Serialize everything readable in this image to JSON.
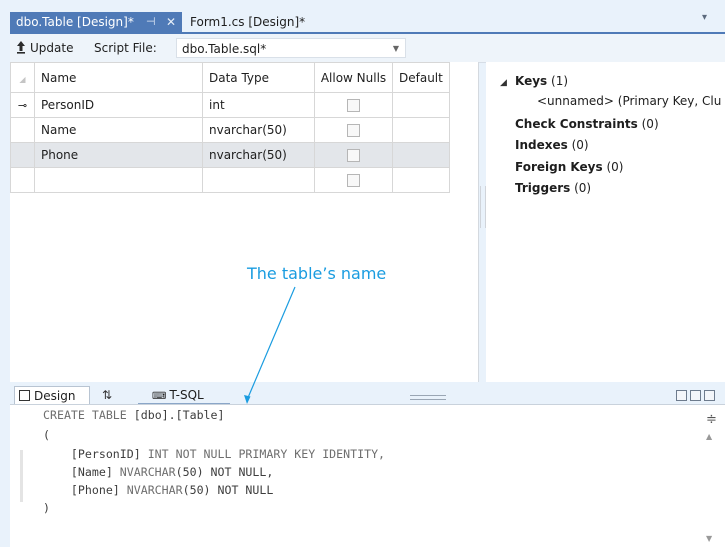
{
  "tabs": {
    "active": {
      "label": "dbo.Table [Design]*",
      "pin": "⊣",
      "close": "✕"
    },
    "inactive": {
      "label": "Form1.cs [Design]*"
    },
    "overflow": "▾"
  },
  "toolbar": {
    "update_label": "Update",
    "script_file_label": "Script File:",
    "script_file_value": "dbo.Table.sql*"
  },
  "grid": {
    "headers": [
      "Name",
      "Data Type",
      "Allow Nulls",
      "Default"
    ],
    "rows": [
      {
        "name": "PersonID",
        "type": "int",
        "allow_nulls": false,
        "primary_key": true
      },
      {
        "name": "Name",
        "type": "nvarchar(50)",
        "allow_nulls": false,
        "primary_key": false
      },
      {
        "name": "Phone",
        "type": "nvarchar(50)",
        "allow_nulls": false,
        "primary_key": false,
        "selected": true
      },
      {
        "name": "",
        "type": "",
        "allow_nulls": false,
        "primary_key": false
      }
    ]
  },
  "properties": {
    "keys_label": "Keys",
    "keys_count": "(1)",
    "keys_item": "<unnamed>  (Primary Key, Clu",
    "check_label": "Check Constraints",
    "check_count": "(0)",
    "indexes_label": "Indexes",
    "indexes_count": "(0)",
    "fk_label": "Foreign Keys",
    "fk_count": "(0)",
    "triggers_label": "Triggers",
    "triggers_count": "(0)"
  },
  "bottom_tabs": {
    "design": "Design",
    "swap": "⇅",
    "tsql": "T-SQL"
  },
  "editor": {
    "line1_kw": "CREATE TABLE ",
    "line1_rest": "[dbo].[Table]",
    "line2": "(",
    "line3_a": "    [PersonID] ",
    "line3_b": "INT NOT NULL PRIMARY KEY IDENTITY,",
    "line4_a": "    [Name] ",
    "line4_b": "NVARCHAR",
    "line4_c": "(50) NOT NULL,",
    "line5_a": "    [Phone] ",
    "line5_b": "NVARCHAR",
    "line5_c": "(50) NOT NULL",
    "line6": ")"
  },
  "annotation": "The table’s name"
}
